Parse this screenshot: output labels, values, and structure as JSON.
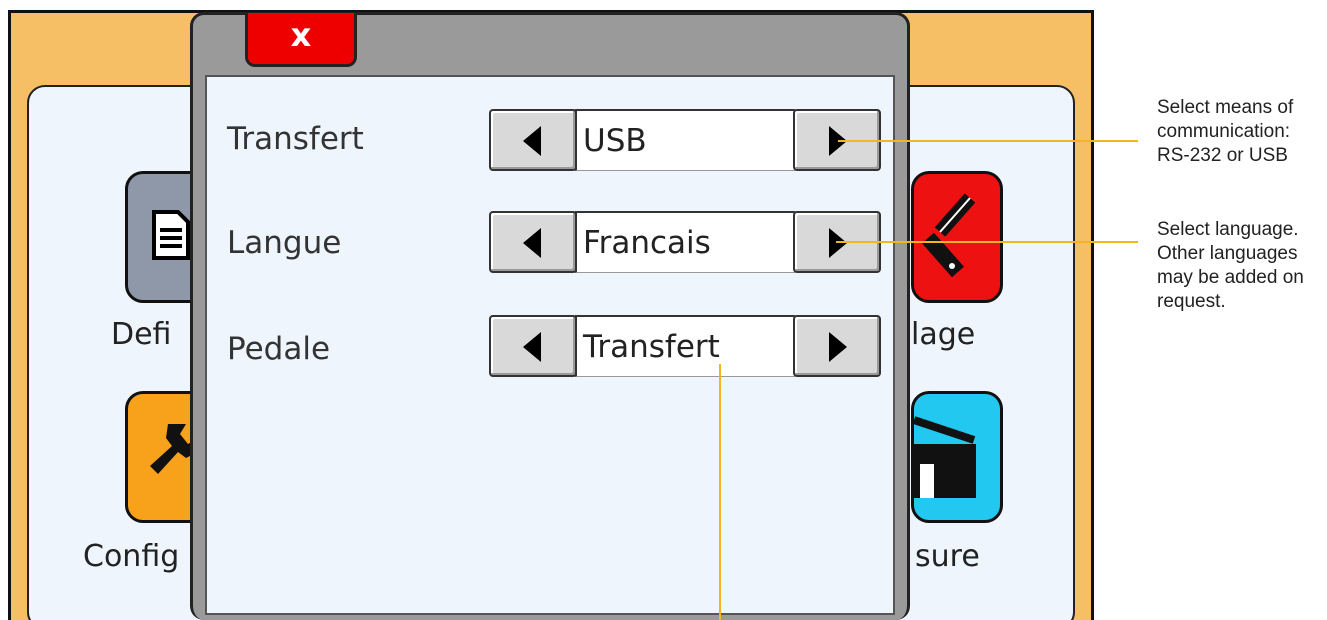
{
  "dialog": {
    "close_label": "x",
    "rows": [
      {
        "label": "Transfert",
        "value": "USB"
      },
      {
        "label": "Langue",
        "value": "Francais"
      },
      {
        "label": "Pedale",
        "value": "Transfert"
      }
    ]
  },
  "background_apps": {
    "left_top_label": "Defi",
    "left_bottom_label": "Config",
    "right_top_label": "lage",
    "right_bottom_label": "sure"
  },
  "annotations": {
    "transfert_note": [
      "Select means of",
      "communication:",
      "RS-232 or USB"
    ],
    "langue_note": [
      "Select language.",
      "Other languages",
      "may be added on",
      "request."
    ]
  },
  "colors": {
    "header": "#f6bf66",
    "panel": "#eef5fd",
    "close_button": "#ee0000",
    "leader_line": "#f6b41e",
    "definition_icon": "#8e98a8",
    "config_icon": "#f7a21a",
    "calibration_icon": "#ee1111",
    "measure_icon": "#22c8f0"
  },
  "icons": [
    "document-icon",
    "wrench-icon",
    "brush-icon",
    "house-icon",
    "triangle-left-icon",
    "triangle-right-icon"
  ]
}
